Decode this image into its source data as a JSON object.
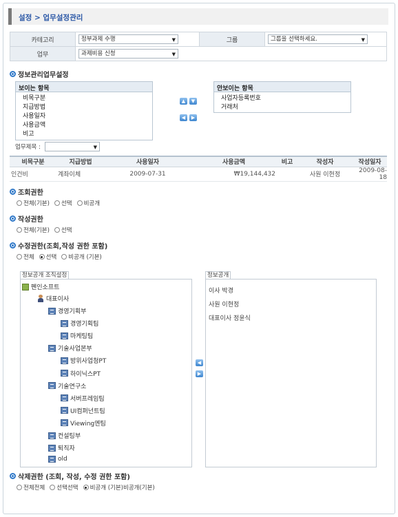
{
  "breadcrumb": "설정 > 업무설정관리",
  "filter": {
    "category_label": "카테고리",
    "category_value": "정부과제 수행",
    "group_label": "그룹",
    "group_value": "그룹을 선택하세요.",
    "task_label": "업무",
    "task_value": "과제비용 신청"
  },
  "info_section": {
    "title": "정보관리업무설정",
    "visible_header": "보이는 항목",
    "visible_items": [
      "비목구분",
      "지급방법",
      "사용일자",
      "사용금액",
      "비고"
    ],
    "hidden_header": "안보이는 항목",
    "hidden_items": [
      "사업자등록번호",
      "거래처"
    ],
    "subject_label": "업무제목 :",
    "subject_value": ""
  },
  "grid": {
    "headers": [
      "비목구분",
      "지급방법",
      "사용일자",
      "사용금액",
      "비고",
      "작성자",
      "작성일자"
    ],
    "row": [
      "인건비",
      "계좌이체",
      "2009-07-31",
      "₩19,144,432",
      "",
      "사원 이현정",
      "2009-08-18"
    ]
  },
  "view_perm": {
    "title": "조회권한",
    "options": [
      "전체(기본)",
      "선택",
      "비공개"
    ],
    "selected": -1
  },
  "write_perm": {
    "title": "작성권한",
    "options": [
      "전체(기본)",
      "선택"
    ],
    "selected": -1
  },
  "edit_perm": {
    "title": "수정권한(조회,작성 권한 포함)",
    "options": [
      "전체",
      "선택",
      "비공개 (기본)"
    ],
    "selected": 1
  },
  "org_panel": {
    "tab": "정보공개 조직설정",
    "root": "펜인소프트",
    "ceo": "대표이사",
    "nodes": [
      {
        "label": "경영기획부",
        "level": 2
      },
      {
        "label": "경영기획팀",
        "level": 3
      },
      {
        "label": "마케팅팀",
        "level": 3
      },
      {
        "label": "기술사업본부",
        "level": 2
      },
      {
        "label": "방위사업청PT",
        "level": 3
      },
      {
        "label": "하이닉스PT",
        "level": 3
      },
      {
        "label": "기술연구소",
        "level": 2
      },
      {
        "label": "서버프레임팀",
        "level": 3
      },
      {
        "label": "UI컴퍼넌트팀",
        "level": 3
      },
      {
        "label": "Viewing엔팀",
        "level": 3
      },
      {
        "label": "컨설팅부",
        "level": 2
      },
      {
        "label": "퇴직자",
        "level": 2
      },
      {
        "label": "old",
        "level": 2
      }
    ]
  },
  "open_panel": {
    "tab": "정보공개",
    "items": [
      "이사 박경",
      "사원 이현정",
      "대표이사 정윤식"
    ]
  },
  "delete_perm": {
    "title": "삭제권한 (조회, 작성, 수정 권한 포함)",
    "options": [
      "전체전체",
      "선택선택",
      "비공개 (기본)비공개(기본)"
    ],
    "selected": 2
  }
}
